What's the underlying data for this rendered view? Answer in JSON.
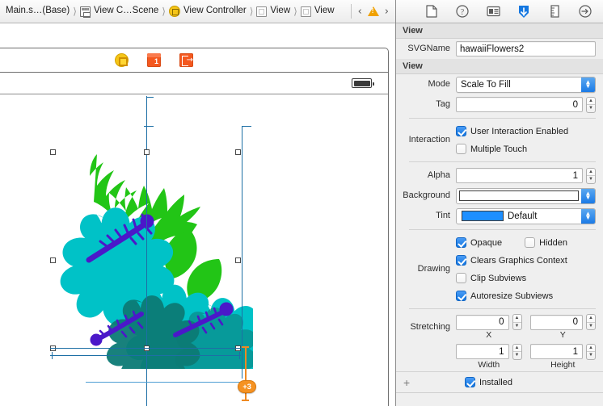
{
  "breadcrumb": {
    "items": [
      {
        "label": "Main.s…(Base)",
        "icon": "none"
      },
      {
        "label": "View C…Scene",
        "icon": "scene-icon"
      },
      {
        "label": "View Controller",
        "icon": "view-controller-icon"
      },
      {
        "label": "View",
        "icon": "view-icon"
      },
      {
        "label": "View",
        "icon": "view-icon"
      }
    ],
    "prev_label": "‹",
    "next_label": "›",
    "warning_icon": "warning-triangle-icon"
  },
  "canvas": {
    "dock": [
      {
        "name": "view-controller-dock-icon",
        "title": "View Controller"
      },
      {
        "name": "first-responder-dock-icon",
        "title": "First Responder"
      },
      {
        "name": "exit-dock-icon",
        "title": "Exit"
      }
    ],
    "status_bar": {
      "battery_icon": "battery-icon"
    },
    "constraint_badge": "+3",
    "artwork": {
      "name": "hawaiiFlowers2",
      "colors": {
        "leaf_green": "#22c516",
        "flower_teal": "#00c2c7",
        "flower_dark_teal": "#0c7a75",
        "stamen_purple": "#4b18c9"
      }
    },
    "selection": {
      "handles": 6
    }
  },
  "inspector": {
    "tabs": [
      {
        "name": "file-inspector-tab",
        "icon": "document-icon",
        "selected": false
      },
      {
        "name": "quick-help-tab",
        "icon": "question-circle-icon",
        "selected": false
      },
      {
        "name": "identity-inspector-tab",
        "icon": "identity-card-icon",
        "selected": false
      },
      {
        "name": "attributes-inspector-tab",
        "icon": "attributes-shield-icon",
        "selected": true
      },
      {
        "name": "size-inspector-tab",
        "icon": "ruler-icon",
        "selected": false
      },
      {
        "name": "connections-inspector-tab",
        "icon": "arrow-circle-icon",
        "selected": false
      }
    ],
    "accent_color": "#1577e0",
    "custom_section": {
      "header": "View",
      "svgname": {
        "label": "SVGName",
        "value": "hawaiiFlowers2",
        "placeholder": ""
      }
    },
    "view_section": {
      "header": "View",
      "mode": {
        "label": "Mode",
        "value": "Scale To Fill"
      },
      "tag": {
        "label": "Tag",
        "value": "0"
      },
      "interaction": {
        "label": "Interaction",
        "user_interaction_enabled": {
          "label": "User Interaction Enabled",
          "checked": true
        },
        "multiple_touch": {
          "label": "Multiple Touch",
          "checked": false
        }
      },
      "alpha": {
        "label": "Alpha",
        "value": "1"
      },
      "background": {
        "label": "Background",
        "value": "",
        "swatch": "#ffffff"
      },
      "tint": {
        "label": "Tint",
        "value": "Default",
        "swatch": "#1e8fff"
      },
      "drawing": {
        "label": "Drawing",
        "opaque": {
          "label": "Opaque",
          "checked": true
        },
        "hidden": {
          "label": "Hidden",
          "checked": false
        },
        "clears_graphics_context": {
          "label": "Clears Graphics Context",
          "checked": true
        },
        "clip_subviews": {
          "label": "Clip Subviews",
          "checked": false
        },
        "autoresize_subviews": {
          "label": "Autoresize Subviews",
          "checked": true
        }
      },
      "stretching": {
        "label": "Stretching",
        "x": {
          "caption": "X",
          "value": "0"
        },
        "y": {
          "caption": "Y",
          "value": "0"
        },
        "width": {
          "caption": "Width",
          "value": "1"
        },
        "height": {
          "caption": "Height",
          "value": "1"
        }
      }
    },
    "footer": {
      "add_label": "+",
      "installed": {
        "label": "Installed",
        "checked": true
      }
    }
  }
}
